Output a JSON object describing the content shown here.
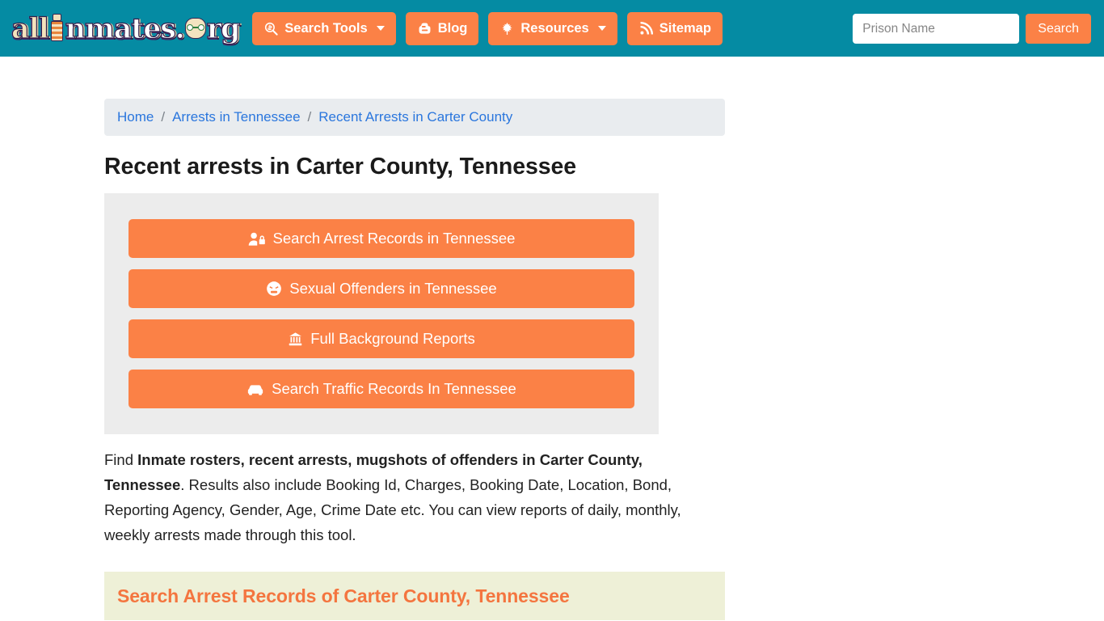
{
  "header": {
    "logo": {
      "text_before": "all",
      "letter_i": "I",
      "text_mid": "nmates.",
      "text_o": "o",
      "text_after": "rg",
      "alt": "allInmates.org"
    },
    "nav": [
      {
        "label": "Search Tools",
        "icon": "search-dollar-icon",
        "caret": true
      },
      {
        "label": "Blog",
        "icon": "blogger-icon",
        "caret": false
      },
      {
        "label": "Resources",
        "icon": "leaf-icon",
        "caret": true
      },
      {
        "label": "Sitemap",
        "icon": "rss-icon",
        "caret": false
      }
    ],
    "search": {
      "placeholder": "Prison Name",
      "value": "",
      "button_label": "Search"
    },
    "colors": {
      "bar": "#058ba3",
      "accent": "#fb8146"
    }
  },
  "breadcrumb": {
    "items": [
      {
        "label": "Home"
      },
      {
        "label": "Arrests in Tennessee"
      },
      {
        "label": "Recent Arrests in Carter County"
      }
    ],
    "separator": "/"
  },
  "main": {
    "title": "Recent arrests in Carter County, Tennessee",
    "action_buttons": [
      {
        "label": "Search Arrest Records in Tennessee",
        "icon": "user-lock-icon"
      },
      {
        "label": "Sexual Offenders in Tennessee",
        "icon": "angry-face-icon"
      },
      {
        "label": "Full Background Reports",
        "icon": "landmark-icon"
      },
      {
        "label": "Search Traffic Records In Tennessee",
        "icon": "car-icon"
      }
    ],
    "paragraph": {
      "lead": "Find ",
      "bold": "Inmate rosters, recent arrests, mugshots of offenders in Carter County, Tennessee",
      "rest": ". Results also include Booking Id, Charges, Booking Date, Location, Bond, Reporting Agency, Gender, Age, Crime Date etc. You can view reports of daily, monthly, weekly arrests made through this tool."
    },
    "banner": {
      "heading": "Search Arrest Records of Carter County, Tennessee",
      "bg_color": "#eef0d7",
      "text_color": "#f4753f"
    }
  }
}
